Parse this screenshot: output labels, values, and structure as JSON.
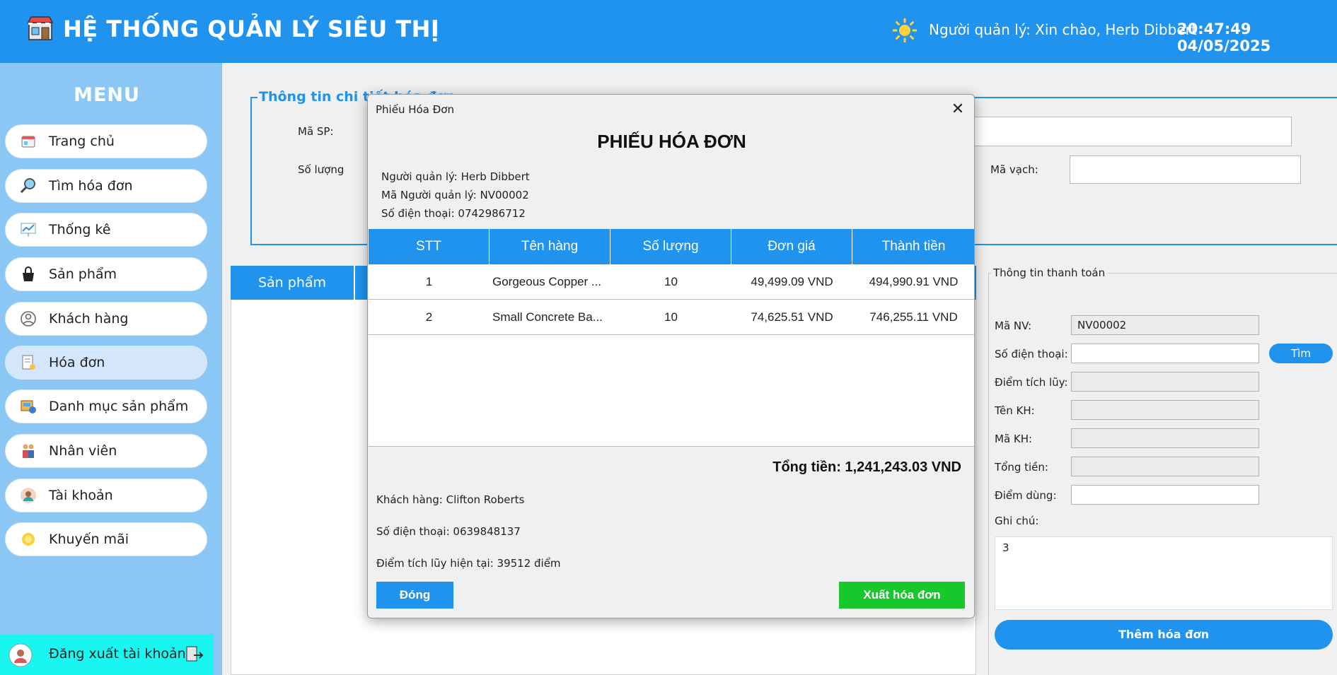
{
  "header": {
    "title": "HỆ THỐNG QUẢN LÝ SIÊU THỊ",
    "greeting": "Người quản lý: Xin chào, Herb Dibbert",
    "time": "20:47:49",
    "date": "04/05/2025",
    "accent_color": "#1f93ee"
  },
  "sidebar": {
    "menu_title": "MENU",
    "items": [
      {
        "label": "Trang chủ",
        "icon": "home-icon"
      },
      {
        "label": "Tìm hóa đơn",
        "icon": "search-invoice-icon"
      },
      {
        "label": "Thống kê",
        "icon": "statistics-icon"
      },
      {
        "label": "Sản phẩm",
        "icon": "product-icon"
      },
      {
        "label": "Khách hàng",
        "icon": "customer-icon"
      },
      {
        "label": "Hóa đơn",
        "icon": "invoice-icon",
        "active": true
      },
      {
        "label": "Danh mục sản phẩm",
        "icon": "category-icon"
      },
      {
        "label": "Nhân viên",
        "icon": "employee-icon"
      },
      {
        "label": "Tài khoản",
        "icon": "account-icon"
      },
      {
        "label": "Khuyến mãi",
        "icon": "promotion-icon"
      }
    ],
    "logout_label": "Đăng xuất tài khoản"
  },
  "detail": {
    "title": "Thông tin chi tiết hóa đơn",
    "product_code_label": "Mã SP:",
    "quantity_label": "Số lượng",
    "barcode_label": "Mã vạch:"
  },
  "product_tab": {
    "label": "Sản phẩm"
  },
  "payment": {
    "title": "Thông tin thanh toán",
    "employee_id_label": "Mã NV:",
    "employee_id_value": "NV00002",
    "phone_label": "Số điện thoại:",
    "search_button": "Tìm",
    "points_label": "Điểm tích lũy:",
    "customer_name_label": "Tên KH:",
    "customer_id_label": "Mã KH:",
    "total_label": "Tổng tiền:",
    "use_points_label": "Điểm dùng:",
    "note_label": "Ghi chú:",
    "note_value": "3",
    "add_button": "Thêm hóa đơn"
  },
  "dialog": {
    "window_title": "Phiếu Hóa Đơn",
    "heading": "PHIẾU HÓA ĐƠN",
    "manager_name": "Người quản lý: Herb Dibbert",
    "manager_id": "Mã Người quản lý: NV00002",
    "manager_phone": "Số điện thoại: 0742986712",
    "columns": [
      "STT",
      "Tên hàng",
      "Số lượng",
      "Đơn giá",
      "Thành tiền"
    ],
    "rows": [
      [
        "1",
        "Gorgeous Copper ...",
        "10",
        "49,499.09 VND",
        "494,990.91 VND"
      ],
      [
        "2",
        "Small Concrete Ba...",
        "10",
        "74,625.51 VND",
        "746,255.11 VND"
      ]
    ],
    "total": "Tổng tiền: 1,241,243.03 VND",
    "customer": "Khách hàng: Clifton Roberts",
    "customer_phone": "Số điện thoại: 0639848137",
    "customer_points": "Điểm tích lũy hiện tại: 39512 điểm",
    "close_button": "Đóng",
    "export_button": "Xuất hóa đơn"
  }
}
